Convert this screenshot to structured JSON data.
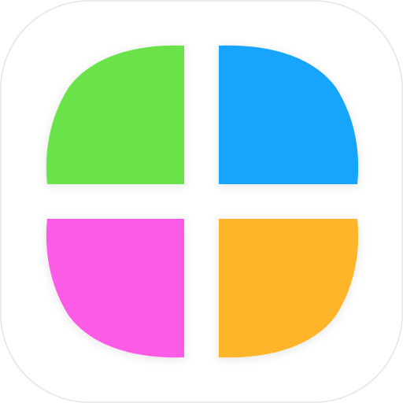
{
  "icon": {
    "petals": [
      {
        "name": "top-left",
        "color": "#6be24a"
      },
      {
        "name": "top-right",
        "color": "#14a5fb"
      },
      {
        "name": "bottom-left",
        "color": "#fc5be5"
      },
      {
        "name": "bottom-right",
        "color": "#feb52c"
      }
    ],
    "tile_color": "#ffffff",
    "tile_border_color": "#e4e4e4"
  }
}
